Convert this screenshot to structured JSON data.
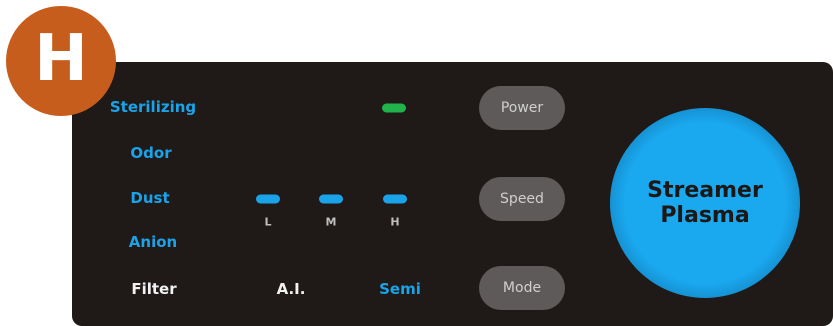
{
  "badge": {
    "letter": "H"
  },
  "indicators": {
    "sterilizing": "Sterilizing",
    "odor": "Odor",
    "dust": "Dust",
    "anion": "Anion"
  },
  "bottom_row": {
    "filter": "Filter",
    "ai": "A.I.",
    "semi": "Semi"
  },
  "speed_levels": [
    "L",
    "M",
    "H"
  ],
  "buttons": {
    "power": "Power",
    "speed": "Speed",
    "mode": "Mode"
  },
  "plasma": {
    "line1": "Streamer",
    "line2": "Plasma"
  },
  "colors": {
    "panel": "#1f1917",
    "badge": "#c75d1c",
    "accent_blue": "#1aa3e8",
    "led_green": "#22b24c",
    "button": "#5e5a59"
  }
}
